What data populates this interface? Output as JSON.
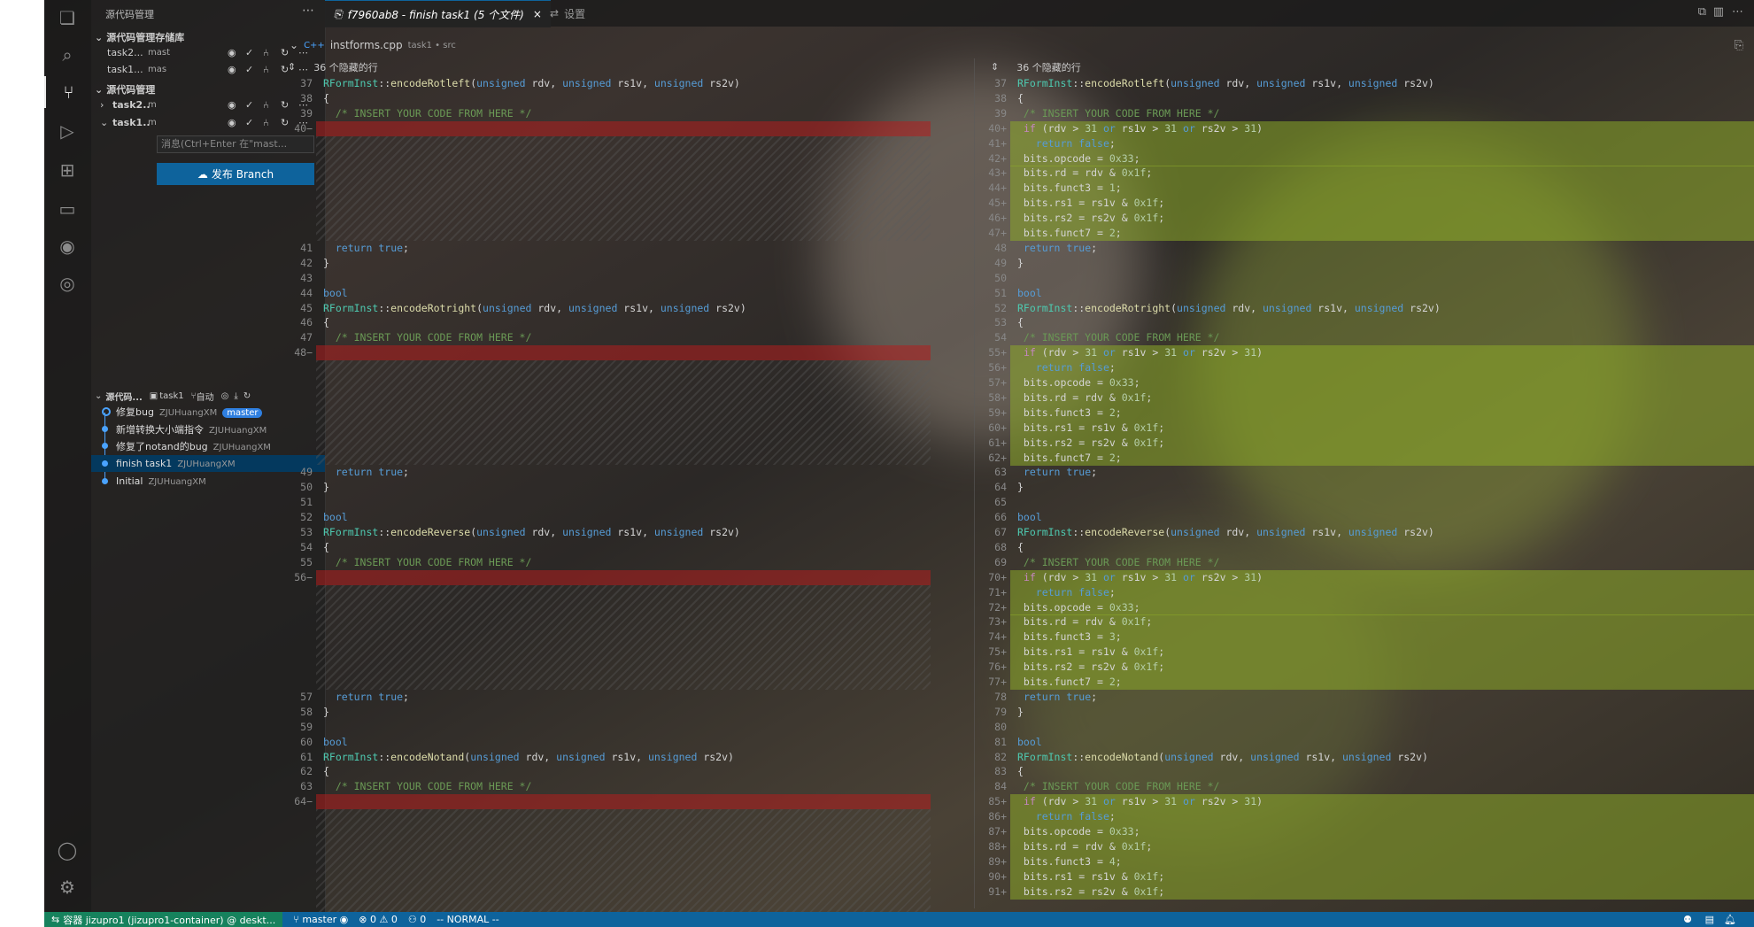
{
  "sidebar": {
    "title": "源代码管理",
    "repos_section": "源代码管理存储库",
    "repos": [
      {
        "name": "task2...",
        "branch": "mast"
      },
      {
        "name": "task1...",
        "branch": "mas"
      }
    ],
    "changes_section": "源代码管理",
    "change_repos": [
      {
        "name": "task2...",
        "branch": "m"
      },
      {
        "name": "task1...",
        "branch": "m"
      }
    ],
    "message_placeholder": "消息(Ctrl+Enter 在\"mast...",
    "publish_label": "发布 Branch",
    "graph_title": "源代码...",
    "graph_repo": "task1",
    "graph_auto": "自动",
    "commits": [
      {
        "msg": "修复bug",
        "author": "ZJUHuangXM",
        "badge": "master"
      },
      {
        "msg": "新增转换大小端指令",
        "author": "ZJUHuangXM"
      },
      {
        "msg": "修复了notand的bug",
        "author": "ZJUHuangXM"
      },
      {
        "msg": "finish task1",
        "author": "ZJUHuangXM"
      },
      {
        "msg": "Initial",
        "author": "ZJUHuangXM"
      }
    ]
  },
  "tabs": [
    {
      "label": "f7960ab8 - finish task1  (5 个文件)",
      "close": "×"
    },
    {
      "label": "设置"
    }
  ],
  "breadcrumb": {
    "file": "instforms.cpp",
    "path": "task1 • src"
  },
  "diff": {
    "hidden_lines": "36 个隐藏的行",
    "left": [
      {
        "n": "37",
        "t": "RFormInst::encodeRotleft(unsigned rdv, unsigned rs1v, unsigned rs2v)"
      },
      {
        "n": "38",
        "t": "{"
      },
      {
        "n": "39",
        "t": "  /* INSERT YOUR CODE FROM HERE */"
      },
      {
        "n": "40",
        "t": "",
        "del": true
      },
      {
        "n": "41",
        "t": "  return true;"
      },
      {
        "n": "42",
        "t": "}"
      },
      {
        "n": "43",
        "t": ""
      },
      {
        "n": "44",
        "t": "bool"
      },
      {
        "n": "45",
        "t": "RFormInst::encodeRotright(unsigned rdv, unsigned rs1v, unsigned rs2v)"
      },
      {
        "n": "46",
        "t": "{"
      },
      {
        "n": "47",
        "t": "  /* INSERT YOUR CODE FROM HERE */"
      },
      {
        "n": "48",
        "t": "",
        "del": true
      },
      {
        "n": "49",
        "t": "  return true;"
      },
      {
        "n": "50",
        "t": "}"
      },
      {
        "n": "51",
        "t": ""
      },
      {
        "n": "52",
        "t": "bool"
      },
      {
        "n": "53",
        "t": "RFormInst::encodeReverse(unsigned rdv, unsigned rs1v, unsigned rs2v)"
      },
      {
        "n": "54",
        "t": "{"
      },
      {
        "n": "55",
        "t": "  /* INSERT YOUR CODE FROM HERE */"
      },
      {
        "n": "56",
        "t": "",
        "del": true
      },
      {
        "n": "57",
        "t": "  return true;"
      },
      {
        "n": "58",
        "t": "}"
      },
      {
        "n": "59",
        "t": ""
      },
      {
        "n": "60",
        "t": "bool"
      },
      {
        "n": "61",
        "t": "RFormInst::encodeNotand(unsigned rdv, unsigned rs1v, unsigned rs2v)"
      },
      {
        "n": "62",
        "t": "{"
      },
      {
        "n": "63",
        "t": "  /* INSERT YOUR CODE FROM HERE */"
      },
      {
        "n": "64",
        "t": "",
        "del": true
      }
    ],
    "right": [
      {
        "n": "37",
        "t": "RFormInst::encodeRotleft(unsigned rdv, unsigned rs1v, unsigned rs2v)"
      },
      {
        "n": "38",
        "t": "{"
      },
      {
        "n": "39",
        "t": " /* INSERT YOUR CODE FROM HERE */"
      },
      {
        "n": "40",
        "t": " if (rdv > 31 or rs1v > 31 or rs2v > 31)",
        "add": true
      },
      {
        "n": "41",
        "t": "   return false;",
        "add": true
      },
      {
        "n": "42",
        "t": " bits.opcode = 0x33;",
        "add": true
      },
      {
        "n": "43",
        "t": " bits.rd = rdv & 0x1f;",
        "add": true
      },
      {
        "n": "44",
        "t": " bits.funct3 = 1;",
        "add": true
      },
      {
        "n": "45",
        "t": " bits.rs1 = rs1v & 0x1f;",
        "add": true
      },
      {
        "n": "46",
        "t": " bits.rs2 = rs2v & 0x1f;",
        "add": true
      },
      {
        "n": "47",
        "t": " bits.funct7 = 2;",
        "add": true
      },
      {
        "n": "48",
        "t": " return true;"
      },
      {
        "n": "49",
        "t": "}"
      },
      {
        "n": "50",
        "t": ""
      },
      {
        "n": "51",
        "t": "bool"
      },
      {
        "n": "52",
        "t": "RFormInst::encodeRotright(unsigned rdv, unsigned rs1v, unsigned rs2v)"
      },
      {
        "n": "53",
        "t": "{"
      },
      {
        "n": "54",
        "t": " /* INSERT YOUR CODE FROM HERE */"
      },
      {
        "n": "55",
        "t": " if (rdv > 31 or rs1v > 31 or rs2v > 31)",
        "add": true
      },
      {
        "n": "56",
        "t": "   return false;",
        "add": true
      },
      {
        "n": "57",
        "t": " bits.opcode = 0x33;",
        "add": true
      },
      {
        "n": "58",
        "t": " bits.rd = rdv & 0x1f;",
        "add": true
      },
      {
        "n": "59",
        "t": " bits.funct3 = 2;",
        "add": true
      },
      {
        "n": "60",
        "t": " bits.rs1 = rs1v & 0x1f;",
        "add": true
      },
      {
        "n": "61",
        "t": " bits.rs2 = rs2v & 0x1f;",
        "add": true
      },
      {
        "n": "62",
        "t": " bits.funct7 = 2;",
        "add": true
      },
      {
        "n": "63",
        "t": " return true;"
      },
      {
        "n": "64",
        "t": "}"
      },
      {
        "n": "65",
        "t": ""
      },
      {
        "n": "66",
        "t": "bool"
      },
      {
        "n": "67",
        "t": "RFormInst::encodeReverse(unsigned rdv, unsigned rs1v, unsigned rs2v)"
      },
      {
        "n": "68",
        "t": "{"
      },
      {
        "n": "69",
        "t": " /* INSERT YOUR CODE FROM HERE */"
      },
      {
        "n": "70",
        "t": " if (rdv > 31 or rs1v > 31 or rs2v > 31)",
        "add": true
      },
      {
        "n": "71",
        "t": "   return false;",
        "add": true
      },
      {
        "n": "72",
        "t": " bits.opcode = 0x33;",
        "add": true
      },
      {
        "n": "73",
        "t": " bits.rd = rdv & 0x1f;",
        "add": true
      },
      {
        "n": "74",
        "t": " bits.funct3 = 3;",
        "add": true
      },
      {
        "n": "75",
        "t": " bits.rs1 = rs1v & 0x1f;",
        "add": true
      },
      {
        "n": "76",
        "t": " bits.rs2 = rs2v & 0x1f;",
        "add": true
      },
      {
        "n": "77",
        "t": " bits.funct7 = 2;",
        "add": true
      },
      {
        "n": "78",
        "t": " return true;"
      },
      {
        "n": "79",
        "t": "}"
      },
      {
        "n": "80",
        "t": ""
      },
      {
        "n": "81",
        "t": "bool"
      },
      {
        "n": "82",
        "t": "RFormInst::encodeNotand(unsigned rdv, unsigned rs1v, unsigned rs2v)"
      },
      {
        "n": "83",
        "t": "{"
      },
      {
        "n": "84",
        "t": " /* INSERT YOUR CODE FROM HERE */"
      },
      {
        "n": "85",
        "t": " if (rdv > 31 or rs1v > 31 or rs2v > 31)",
        "add": true
      },
      {
        "n": "86",
        "t": "   return false;",
        "add": true
      },
      {
        "n": "87",
        "t": " bits.opcode = 0x33;",
        "add": true
      },
      {
        "n": "88",
        "t": " bits.rd = rdv & 0x1f;",
        "add": true
      },
      {
        "n": "89",
        "t": " bits.funct3 = 4;",
        "add": true
      },
      {
        "n": "90",
        "t": " bits.rs1 = rs1v & 0x1f;",
        "add": true
      },
      {
        "n": "91",
        "t": " bits.rs2 = rs2v & 0x1f;",
        "add": true
      }
    ]
  },
  "status": {
    "remote": "容器 jizupro1 (jizupro1-container) @ deskt...",
    "branch": "master",
    "problems": "0 ⚠ 0",
    "ports": "0",
    "mode": "-- NORMAL --"
  }
}
